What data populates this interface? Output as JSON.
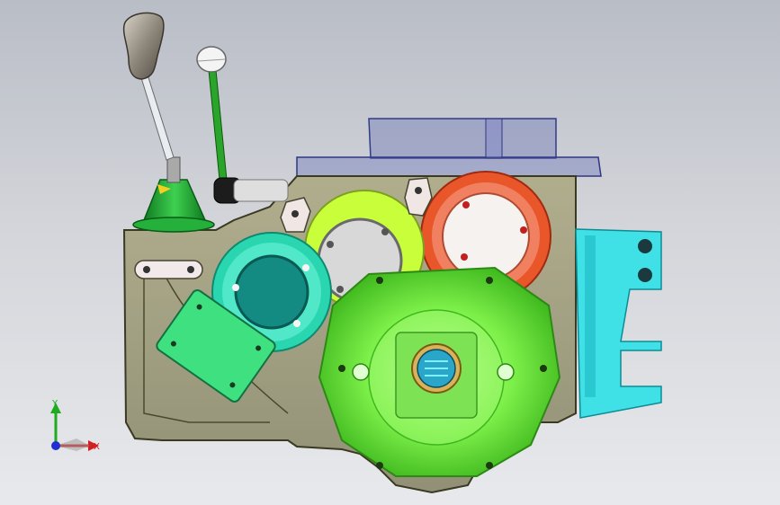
{
  "viewport": {
    "background_top": "#b9bdc6",
    "background_bottom": "#e8e9ec"
  },
  "triad": {
    "x_label": "X",
    "y_label": "Y",
    "x_color": "#d21f1f",
    "y_color": "#1faa1f",
    "z_color": "#1f2fd2"
  },
  "model": {
    "housing_color": "#8e8a55",
    "bell_housing_color": "#7ef04a",
    "bracket_color": "#3fe0e6",
    "gear_colors": [
      "#29d6b0",
      "#c8ff3a",
      "#e8562a"
    ],
    "shifter_knob_color": "#9b9388",
    "shifter_boot_color": "#19b030",
    "selector_lever_color": "#2aa42a",
    "cover_color": "#3ee080",
    "top_cover_color": "#3c4aa0",
    "icons": [
      "shift-lever-icon",
      "selector-lever-icon",
      "gear-icon",
      "bearing-icon",
      "bracket-icon"
    ]
  }
}
